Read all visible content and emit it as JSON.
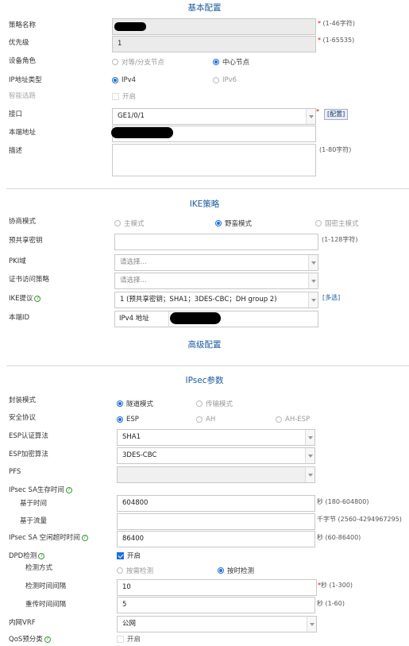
{
  "sections": {
    "basic": "基本配置",
    "ike": "IKE策略",
    "advanced": "高级配置",
    "ipsec": "IPsec参数"
  },
  "basic": {
    "policy_name": {
      "label": "策略名称",
      "hint": "(1-46字符)"
    },
    "priority": {
      "label": "优先级",
      "value": "1",
      "hint": "(1-65535)"
    },
    "device_role": {
      "label": "设备角色",
      "options": [
        "对等/分支节点",
        "中心节点"
      ],
      "selected": 1
    },
    "ip_type": {
      "label": "IP地址类型",
      "options": [
        "IPv4",
        "IPv6"
      ],
      "selected": 0
    },
    "smart_select": {
      "label": "智能选路",
      "option": "开启"
    },
    "interface": {
      "label": "接口",
      "value": "GE1/0/1",
      "config_button": "[配置]"
    },
    "local_addr": {
      "label": "本端地址"
    },
    "description": {
      "label": "描述",
      "hint": "(1-80字符)"
    }
  },
  "ike": {
    "negotiation_mode": {
      "label": "协商模式",
      "options": [
        "主模式",
        "野蛮模式",
        "国密主模式"
      ],
      "selected": 1
    },
    "psk": {
      "label": "预共享密钥",
      "hint": "(1-128字符)"
    },
    "pki_domain": {
      "label": "PKI域",
      "placeholder": "请选择..."
    },
    "cert_policy": {
      "label": "证书访问策略",
      "placeholder": "请选择..."
    },
    "ike_proposal": {
      "label": "IKE提议",
      "value": "1 (预共享密钥；SHA1；3DES-CBC；DH group 2)",
      "multi_link": "[多选]"
    },
    "local_id": {
      "label": "本端ID",
      "type_value": "IPv4 地址"
    }
  },
  "ipsec": {
    "encap_mode": {
      "label": "封装模式",
      "options": [
        "隧道模式",
        "传输模式"
      ],
      "selected": 0
    },
    "security_protocol": {
      "label": "安全协议",
      "options": [
        "ESP",
        "AH",
        "AH-ESP"
      ],
      "selected": 0
    },
    "esp_auth": {
      "label": "ESP认证算法",
      "value": "SHA1"
    },
    "esp_enc": {
      "label": "ESP加密算法",
      "value": "3DES-CBC"
    },
    "pfs": {
      "label": "PFS",
      "value": ""
    },
    "sa_lifetime": {
      "label": "IPsec SA生存时间"
    },
    "time_based": {
      "label": "基于时间",
      "value": "604800",
      "hint": "秒 (180-604800)"
    },
    "traffic_based": {
      "label": "基于流量",
      "value": "",
      "hint": "千字节 (2560-4294967295)"
    },
    "idle_timeout": {
      "label": "IPsec SA 空闲超时时间",
      "value": "86400",
      "hint": "秒 (60-86400)"
    },
    "dpd": {
      "label": "DPD检测",
      "option": "开启",
      "checked": true
    },
    "detect_method": {
      "label": "检测方式",
      "options": [
        "按需检测",
        "按时检测"
      ],
      "selected": 1
    },
    "detect_interval": {
      "label": "检测时间间隔",
      "value": "10",
      "hint": "秒 (1-300)"
    },
    "retry_interval": {
      "label": "重传时间间隔",
      "value": "5",
      "hint": "秒 (1-60)"
    },
    "inner_vrf": {
      "label": "内网VRF",
      "value": "公网"
    },
    "qos": {
      "label": "QoS预分类",
      "option": "开启",
      "checked": false
    }
  },
  "help_icon": "?",
  "colors": {
    "accent": "#1e6fd9",
    "section_title": "#1a5a9c",
    "required": "#e00000"
  }
}
